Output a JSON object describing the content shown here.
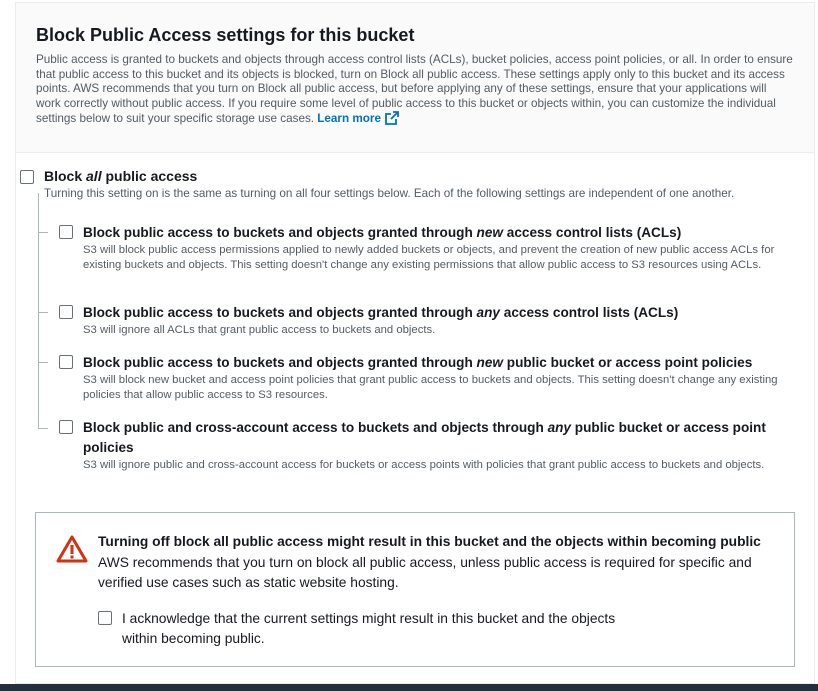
{
  "panel": {
    "title": "Block Public Access settings for this bucket",
    "description": "Public access is granted to buckets and objects through access control lists (ACLs), bucket policies, access point policies, or all. In order to ensure that public access to this bucket and its objects is blocked, turn on Block all public access. These settings apply only to this bucket and its access points. AWS recommends that you turn on Block all public access, but before applying any of these settings, ensure that your applications will work correctly without public access. If you require some level of public access to this bucket or objects within, you can customize the individual settings below to suit your specific storage use cases.",
    "learn_more": "Learn more"
  },
  "master": {
    "label_pre": "Block ",
    "label_em": "all",
    "label_post": " public access",
    "description": "Turning this setting on is the same as turning on all four settings below. Each of the following settings are independent of one another.",
    "checked": false
  },
  "options": [
    {
      "label_pre": "Block public access to buckets and objects granted through ",
      "label_em": "new",
      "label_post": " access control lists (ACLs)",
      "description": "S3 will block public access permissions applied to newly added buckets or objects, and prevent the creation of new public access ACLs for existing buckets and objects. This setting doesn't change any existing permissions that allow public access to S3 resources using ACLs.",
      "checked": false
    },
    {
      "label_pre": "Block public access to buckets and objects granted through ",
      "label_em": "any",
      "label_post": " access control lists (ACLs)",
      "description": "S3 will ignore all ACLs that grant public access to buckets and objects.",
      "checked": false
    },
    {
      "label_pre": "Block public access to buckets and objects granted through ",
      "label_em": "new",
      "label_post": " public bucket or access point policies",
      "description": "S3 will block new bucket and access point policies that grant public access to buckets and objects. This setting doesn't change any existing policies that allow public access to S3 resources.",
      "checked": false
    },
    {
      "label_pre": "Block public and cross-account access to buckets and objects through ",
      "label_em": "any",
      "label_post": " public bucket or access point policies",
      "description": "S3 will ignore public and cross-account access for buckets or access points with policies that grant public access to buckets and objects.",
      "checked": false
    }
  ],
  "alert": {
    "title": "Turning off block all public access might result in this bucket and the objects within becoming public",
    "body": "AWS recommends that you turn on block all public access, unless public access is required for specific and verified use cases such as static website hosting.",
    "ack_label": "I acknowledge that the current settings might result in this bucket and the objects within becoming public.",
    "ack_checked": false
  },
  "colors": {
    "link": "#0073bb",
    "warning": "#d13212",
    "nav_bar": "#232f3e"
  }
}
